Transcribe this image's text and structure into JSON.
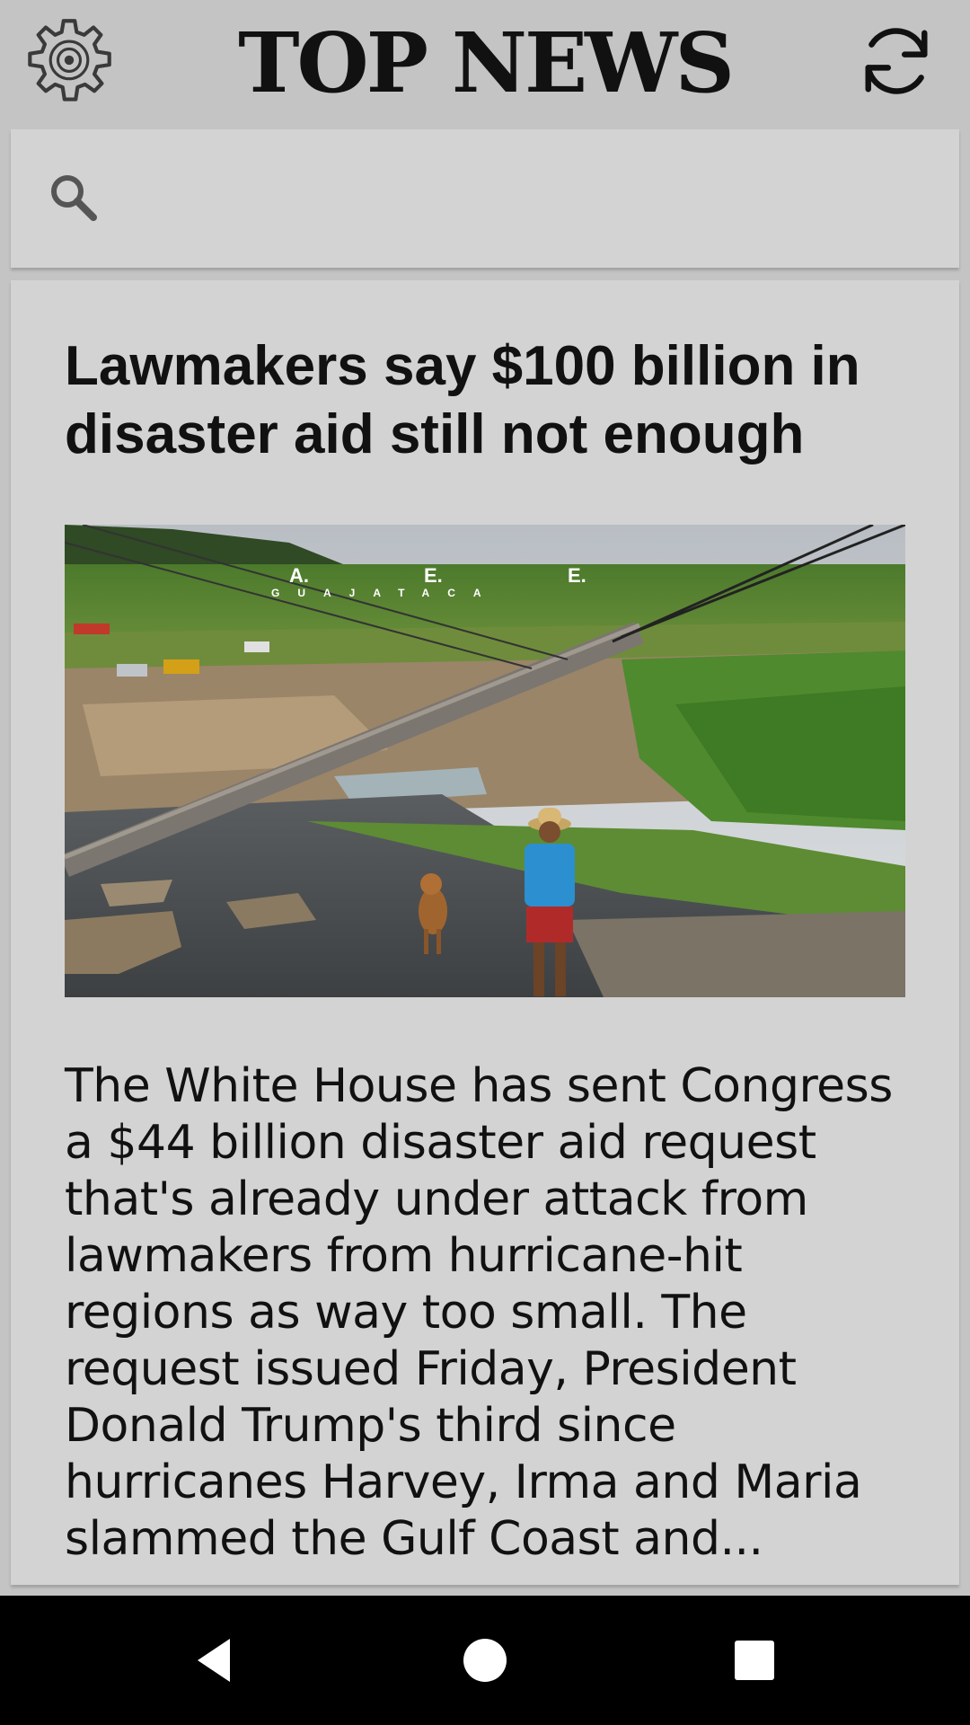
{
  "app_bar": {
    "title": "TOP NEWS",
    "settings_icon": "gear-icon",
    "refresh_icon": "refresh-icon"
  },
  "search": {
    "icon": "search-icon",
    "value": "",
    "placeholder": ""
  },
  "article": {
    "headline": "Lawmakers say $100 billion in disaster aid still not enough",
    "summary": "The White House has sent Congress a $44 billion disaster aid request that's already under attack from lawmakers from hurricane-hit regions as way too small. The request issued Friday, President Donald Trump's third since hurricanes Harvey, Irma and Maria slammed the Gulf Coast and...",
    "image_sign": "A. E. E. GUAJATACA"
  },
  "nav_bar": {
    "back_icon": "back-icon",
    "home_icon": "home-icon",
    "recents_icon": "recents-icon"
  },
  "colors": {
    "background": "#c4c4c4",
    "card": "#d3d3d3",
    "nav_bar": "#000000"
  }
}
